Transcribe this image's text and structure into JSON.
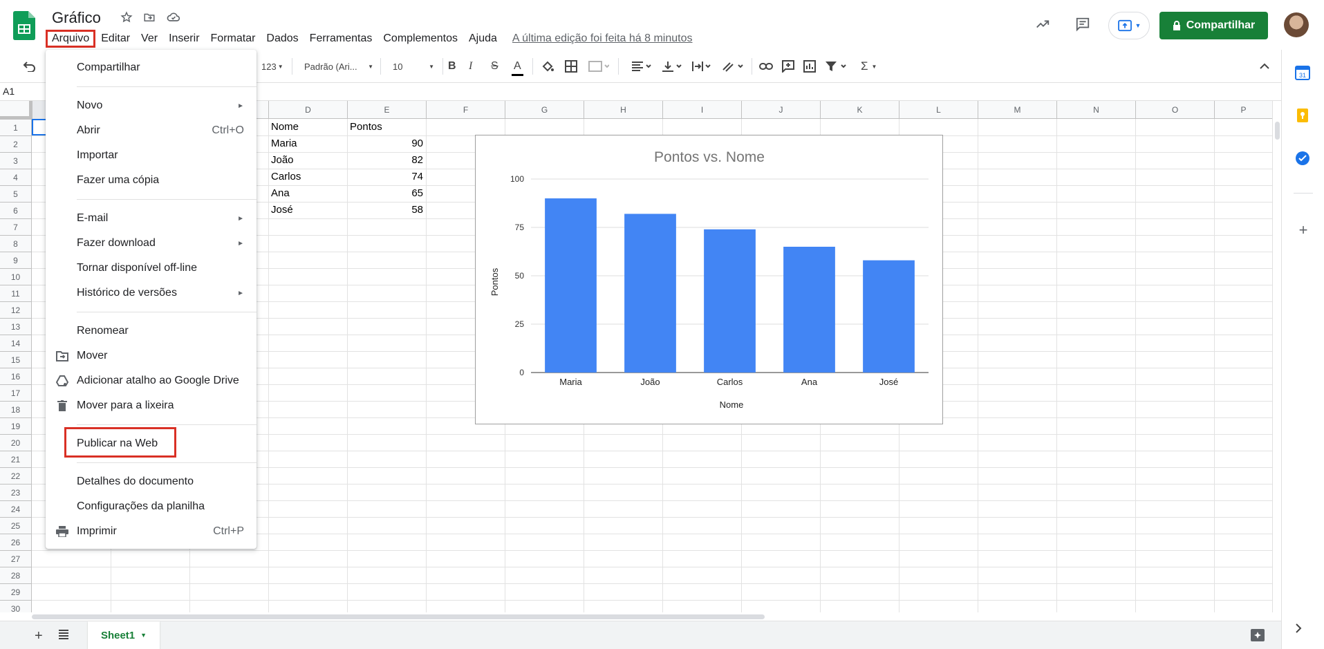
{
  "header": {
    "doc_title": "Gráfico",
    "icons": [
      "star-icon",
      "move-to-folder-icon",
      "cloud-status-icon"
    ],
    "menus": [
      "Arquivo",
      "Editar",
      "Ver",
      "Inserir",
      "Formatar",
      "Dados",
      "Ferramentas",
      "Complementos",
      "Ajuda"
    ],
    "last_edit": "A última edição foi feita há 8 minutos",
    "share_label": "Compartilhar"
  },
  "toolbar": {
    "format_label": "123",
    "font_label": "Padrão (Ari...",
    "size_label": "10",
    "bold": "B",
    "italic": "I",
    "strike": "S",
    "textcolor": "A",
    "sigma": "Σ"
  },
  "formula": {
    "cellref": "A1"
  },
  "grid": {
    "columns": [
      "D",
      "E",
      "F",
      "G",
      "H",
      "I",
      "J",
      "K",
      "L",
      "M",
      "N",
      "O",
      "P"
    ],
    "rows": [
      "1",
      "2",
      "3",
      "4",
      "5",
      "6",
      "7",
      "8",
      "9",
      "10",
      "11",
      "12",
      "13",
      "14",
      "15",
      "16",
      "17",
      "18",
      "19",
      "20",
      "21",
      "22",
      "23",
      "24",
      "25",
      "26",
      "27",
      "28",
      "29",
      "30"
    ],
    "header_d": "Nome",
    "header_e": "Pontos",
    "names": [
      "Maria",
      "João",
      "Carlos",
      "Ana",
      "José"
    ],
    "scores": [
      "90",
      "82",
      "74",
      "65",
      "58"
    ]
  },
  "chart_data": {
    "type": "bar",
    "title": "Pontos vs. Nome",
    "xlabel": "Nome",
    "ylabel": "Pontos",
    "categories": [
      "Maria",
      "João",
      "Carlos",
      "Ana",
      "José"
    ],
    "values": [
      90,
      82,
      74,
      65,
      58
    ],
    "ylim": [
      0,
      100
    ],
    "yticks": [
      "0",
      "25",
      "50",
      "75",
      "100"
    ],
    "color": "#4285f4"
  },
  "sheet": {
    "tab": "Sheet1"
  },
  "file_menu": {
    "compartilhar": "Compartilhar",
    "novo": "Novo",
    "abrir": "Abrir",
    "abrir_sc": "Ctrl+O",
    "importar": "Importar",
    "copia": "Fazer uma cópia",
    "email": "E-mail",
    "download": "Fazer download",
    "offline": "Tornar disponível off-line",
    "historico": "Histórico de versões",
    "renomear": "Renomear",
    "mover": "Mover",
    "atalho": "Adicionar atalho ao Google Drive",
    "lixeira": "Mover para a lixeira",
    "publicar": "Publicar na Web",
    "detalhes": "Detalhes do documento",
    "config": "Configurações da planilha",
    "imprimir": "Imprimir",
    "imprimir_sc": "Ctrl+P"
  },
  "colors": {
    "accent": "#1a73e8",
    "share_green": "#188038",
    "highlight_red": "#d93025",
    "bar_blue": "#4285f4"
  }
}
